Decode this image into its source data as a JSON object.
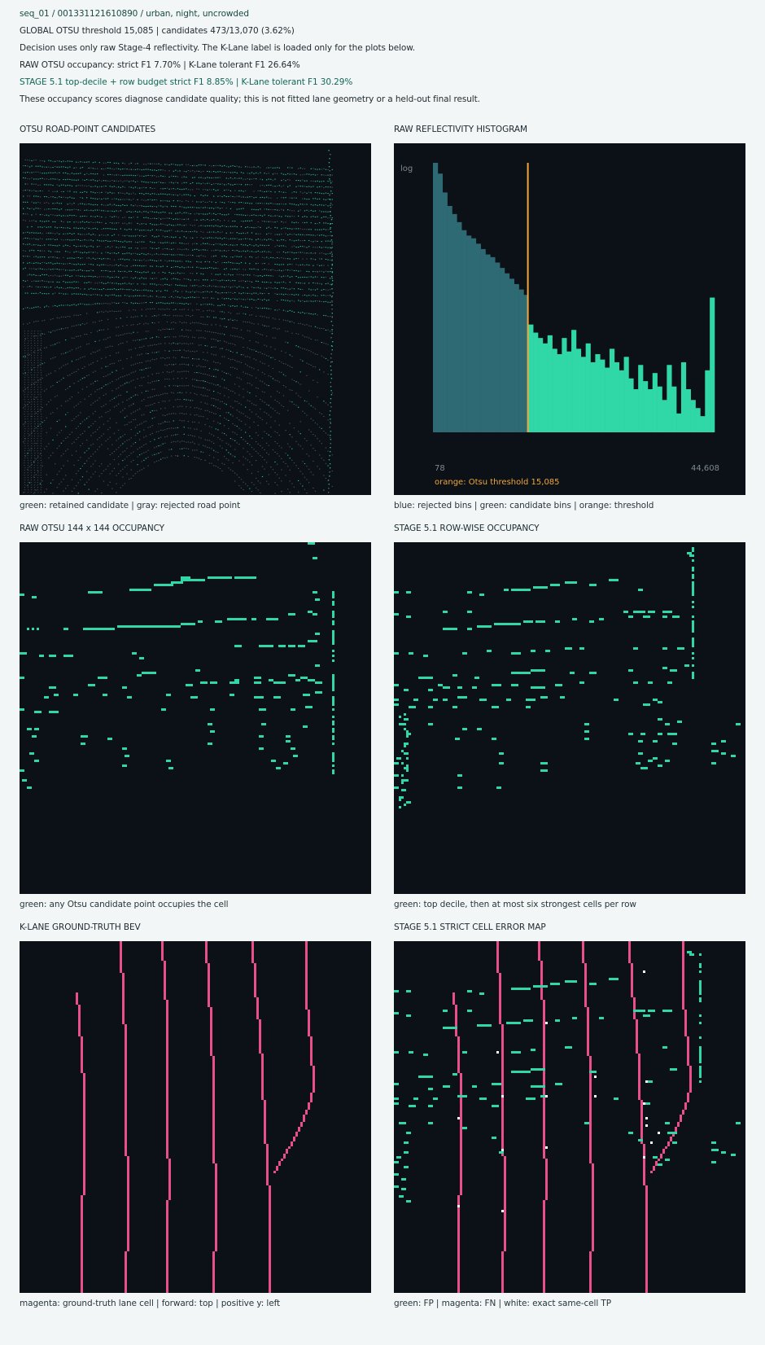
{
  "header": {
    "line1": "seq_01 / 001331121610890 / urban, night, uncrowded",
    "line2": "GLOBAL OTSU threshold 15,085 | candidates 473/13,070 (3.62%)",
    "line3": "Decision uses only raw Stage-4 reflectivity. The K-Lane label is loaded only for the plots below.",
    "line4": "RAW OTSU occupancy: strict F1 7.70% | K-Lane tolerant F1 26.64%",
    "line5": "STAGE 5.1 top-decile + row budget strict F1 8.85% | K-Lane tolerant F1 30.29%",
    "line6": "These occupancy scores diagnose candidate quality; this is not fitted lane geometry or a held-out final result."
  },
  "panels": {
    "points": {
      "title": "OTSU ROAD-POINT CANDIDATES",
      "caption": "green: retained candidate | gray: rejected road point"
    },
    "histogram": {
      "title": "RAW REFLECTIVITY HISTOGRAM",
      "caption": "blue: rejected bins | green: candidate bins | orange: threshold"
    },
    "raw_occ": {
      "title": "RAW OTSU 144 x 144 OCCUPANCY",
      "caption": "green: any Otsu candidate point occupies the cell"
    },
    "stage_occ": {
      "title": "STAGE 5.1 ROW-WISE OCCUPANCY",
      "caption": "green: top decile, then at most six strongest cells per row"
    },
    "gt": {
      "title": "K-LANE GROUND-TRUTH BEV",
      "caption": "magenta: ground-truth lane cell | forward: top | positive y: left"
    },
    "error": {
      "title": "STAGE 5.1 STRICT CELL ERROR MAP",
      "caption": "green: FP | magenta: FN | white: exact same-cell TP"
    }
  },
  "colors": {
    "panel_bg": "#0b1116",
    "candidate": "#2fd8a6",
    "rejected": "#6f7f88",
    "rejected_bins": "#2e6a74",
    "threshold": "#f0a63a",
    "lane": "#ea4f8a",
    "tp": "#ffffff"
  },
  "chart_data": [
    {
      "type": "histogram",
      "title": "RAW REFLECTIVITY HISTOGRAM",
      "x_min_label": "78",
      "x_max_label": "44,608",
      "x_range": [
        78,
        44608
      ],
      "y_scale_label": "log",
      "threshold_value": 15085,
      "threshold_label": "orange: Otsu threshold 15,085",
      "bin_count": 59,
      "rejected_bins": 20,
      "log_heights": [
        1.0,
        0.96,
        0.89,
        0.84,
        0.81,
        0.78,
        0.75,
        0.73,
        0.72,
        0.7,
        0.68,
        0.66,
        0.65,
        0.63,
        0.61,
        0.59,
        0.57,
        0.55,
        0.53,
        0.51,
        0.4,
        0.37,
        0.35,
        0.33,
        0.36,
        0.31,
        0.29,
        0.35,
        0.3,
        0.38,
        0.31,
        0.28,
        0.33,
        0.26,
        0.29,
        0.27,
        0.24,
        0.31,
        0.26,
        0.23,
        0.28,
        0.2,
        0.16,
        0.25,
        0.19,
        0.16,
        0.22,
        0.17,
        0.12,
        0.25,
        0.17,
        0.07,
        0.26,
        0.16,
        0.12,
        0.09,
        0.06,
        0.23,
        0.5
      ]
    },
    {
      "type": "scatter",
      "title": "OTSU ROAD-POINT CANDIDATES",
      "series": [
        {
          "name": "retained candidate"
        },
        {
          "name": "rejected road point"
        }
      ]
    }
  ]
}
